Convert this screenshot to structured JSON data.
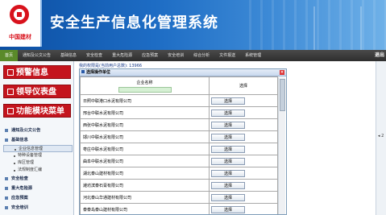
{
  "header": {
    "logo_text": "中国建材",
    "title": "安全生产信息化管理系统"
  },
  "nav": {
    "items": [
      "首页",
      "通知及公文公告",
      "基础信息",
      "安全检查",
      "重大危险源",
      "应急预案",
      "安全培训",
      "综合分析",
      "文件报送",
      "系统管理"
    ],
    "right_label": "退出"
  },
  "sidebar": {
    "big_buttons": [
      "预警信息",
      "领导仪表盘",
      "功能模块菜单"
    ],
    "sections": [
      {
        "label": "通知及公文公告",
        "subs": []
      },
      {
        "label": "基础信息",
        "subs": [
          "企业信息管理",
          "特种设备管理",
          "库区管理",
          "法规制度汇编"
        ]
      },
      {
        "label": "安全检查",
        "subs": []
      },
      {
        "label": "重大危险源",
        "subs": []
      },
      {
        "label": "应急预案",
        "subs": []
      },
      {
        "label": "安全培训",
        "subs": []
      }
    ]
  },
  "main": {
    "info_line": "我的权限是(当前用户总数): 13966",
    "side_arrow": "◂ 2",
    "panel_title": "选择操作单位",
    "table": {
      "headers": [
        "企业名称",
        "选择"
      ],
      "filter_placeholder": "",
      "button_label": "选择",
      "rows": [
        "日照中联港口水泥有限公司",
        "邢台中联水泥有限公司",
        "西张中联水泥有限公司",
        "邯川中联水泥有限公司",
        "枣庄中联水泥有限公司",
        "曲阜中联水泥有限公司",
        "湖北泰山建材有限公司",
        "潍坊滨泰石膏有限公司",
        "河北泰山华通建材有限公司",
        "泰泰岛泰山建材有限公司"
      ]
    }
  }
}
